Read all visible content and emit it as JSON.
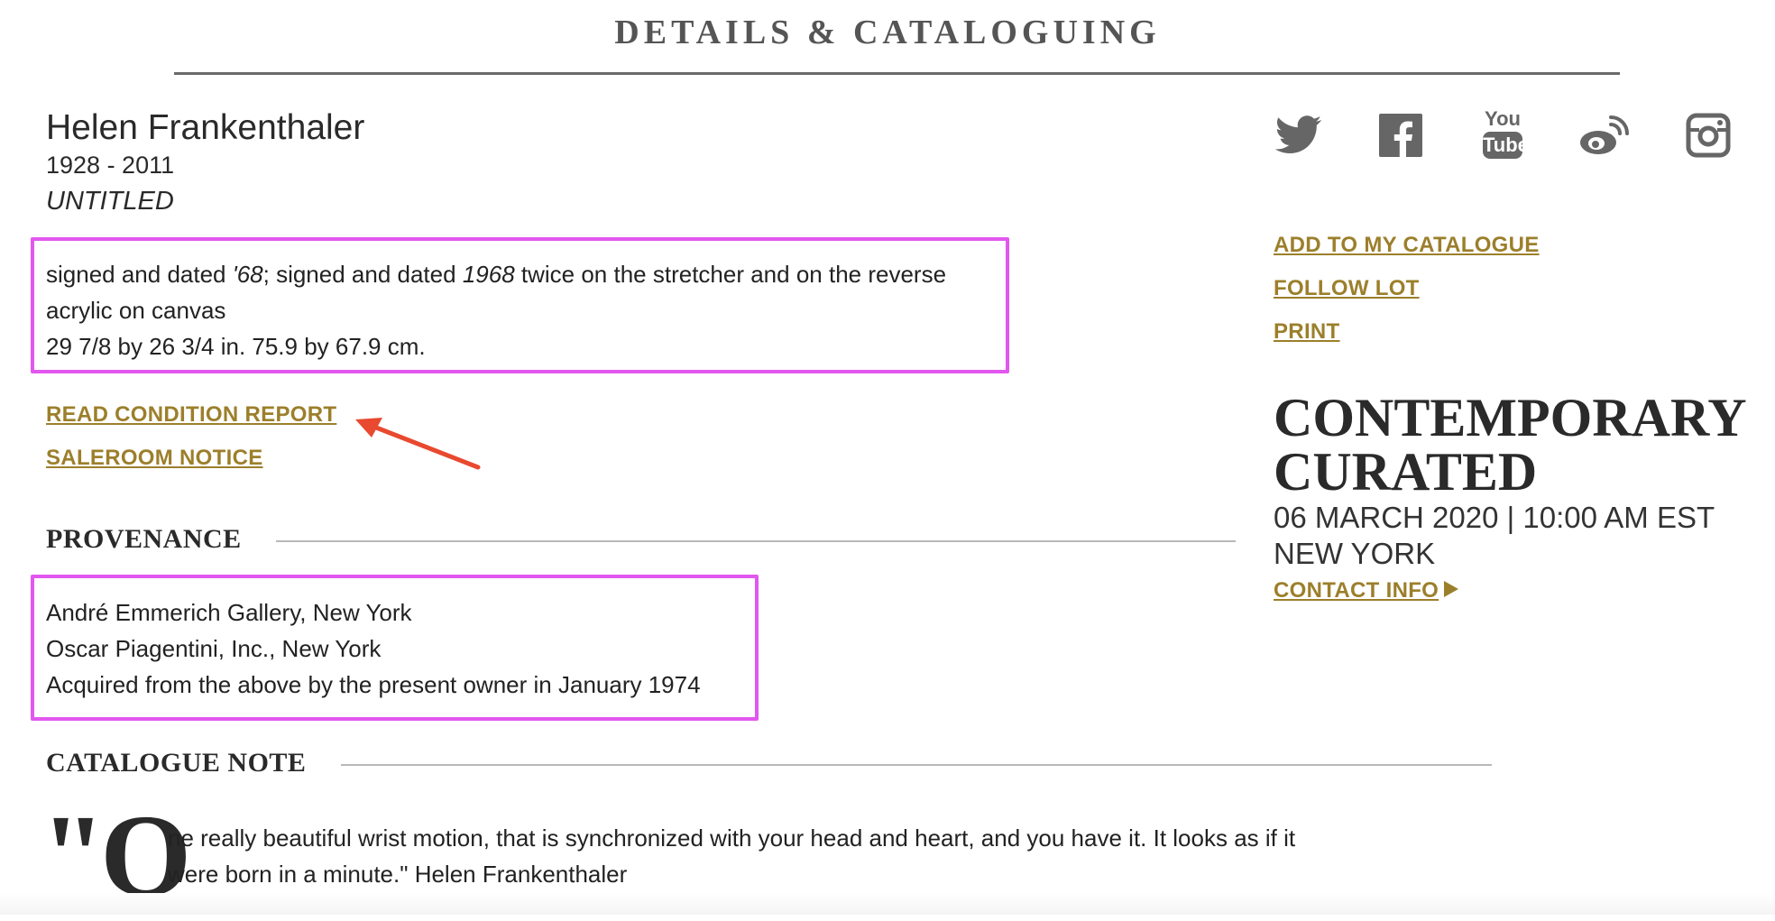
{
  "section_header": "DETAILS & CATALOGUING",
  "artist": {
    "name": "Helen Frankenthaler",
    "dates": "1928 - 2011",
    "title": "UNTITLED"
  },
  "details": {
    "signature_prefix": "signed and dated ",
    "signature_year_short": "'68",
    "signature_mid": "; signed and dated ",
    "signature_year_full": "1968",
    "signature_suffix": " twice on the stretcher and on the reverse",
    "medium": "acrylic on canvas",
    "dimensions": "29 7/8 by 26 3/4 in. 75.9 by 67.9 cm."
  },
  "links": {
    "condition_report": "READ CONDITION REPORT",
    "saleroom_notice": "SALEROOM NOTICE"
  },
  "provenance": {
    "heading": "PROVENANCE",
    "entries": [
      "André Emmerich Gallery, New York",
      "Oscar Piagentini, Inc., New York",
      "Acquired from the above by the present owner in January 1974"
    ]
  },
  "catalogue_note": {
    "heading": "CATALOGUE NOTE",
    "quote_mark": "\"O",
    "line1": "ne really beautiful wrist motion, that is synchronized with your head and heart, and you have it. It looks as if it",
    "line2": "were born in a minute.\" Helen Frankenthaler"
  },
  "social": {
    "icons": [
      "twitter-icon",
      "facebook-icon",
      "youtube-icon",
      "weibo-icon",
      "instagram-icon"
    ],
    "youtube_top": "You",
    "youtube_bottom": "Tube"
  },
  "actions": {
    "add_to_catalogue": "ADD TO MY CATALOGUE",
    "follow_lot": "FOLLOW LOT",
    "print": "PRINT"
  },
  "auction": {
    "title_line1": "CONTEMPORARY",
    "title_line2": "CURATED",
    "date": "06 MARCH 2020 | 10:00 AM EST",
    "location": "NEW YORK",
    "contact": "CONTACT INFO"
  },
  "colors": {
    "gold": "#9c7f2b",
    "highlight": "#e257ee",
    "arrow": "#e8492f",
    "icon_gray": "#666666"
  }
}
